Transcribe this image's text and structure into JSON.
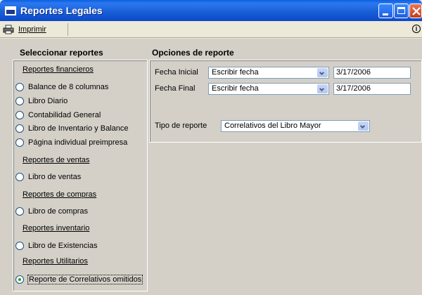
{
  "window": {
    "title": "Reportes Legales"
  },
  "toolbar": {
    "print_label": "Imprimir"
  },
  "left_panel": {
    "header": "Seleccionar reportes",
    "sections": [
      {
        "title": "Reportes financieros",
        "items": [
          "Balance de 8 columnas",
          "Libro Diario",
          "Contabilidad General",
          "Libro de Inventario y Balance",
          "Página individual preimpresa"
        ]
      },
      {
        "title": "Reportes de ventas",
        "items": [
          "Libro de ventas"
        ]
      },
      {
        "title": "Reportes de compras",
        "items": [
          "Libro de compras"
        ]
      },
      {
        "title": "Reportes inventario",
        "items": [
          "Libro de Existencias"
        ]
      },
      {
        "title": "Reportes Utilitarios",
        "items": [
          "Reporte de Correlativos omitidos"
        ]
      }
    ],
    "selected": "Reporte de Correlativos omitidos"
  },
  "right_panel": {
    "header": "Opciones de reporte",
    "fecha_inicial": {
      "label": "Fecha Inicial",
      "mode": "Escribir fecha",
      "date": "3/17/2006"
    },
    "fecha_final": {
      "label": "Fecha Final",
      "mode": "Escribir fecha",
      "date": "3/17/2006"
    },
    "tipo": {
      "label": "Tipo de reporte",
      "value": "Correlativos del Libro Mayor"
    }
  }
}
